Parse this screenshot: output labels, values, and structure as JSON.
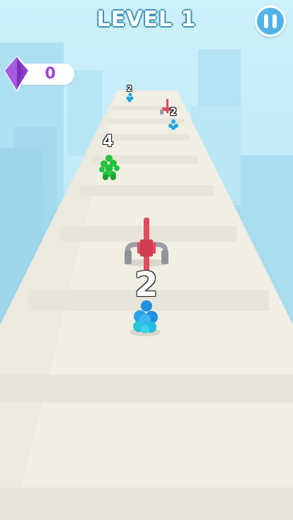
{
  "hud": {
    "level_label": "LEVEL 1",
    "gem_count": "0"
  },
  "labels": {
    "player_count": "2",
    "green_count": "4",
    "far_enemy_count": "2",
    "far_top_count": "2"
  },
  "icons": {
    "pause": "pause-icon",
    "gem": "purple-gem-icon"
  },
  "colors": {
    "player_blue": "#1f8fe0",
    "enemy_green": "#22c23d",
    "saw_red": "#e24a60",
    "track": "#f2f0e6"
  }
}
